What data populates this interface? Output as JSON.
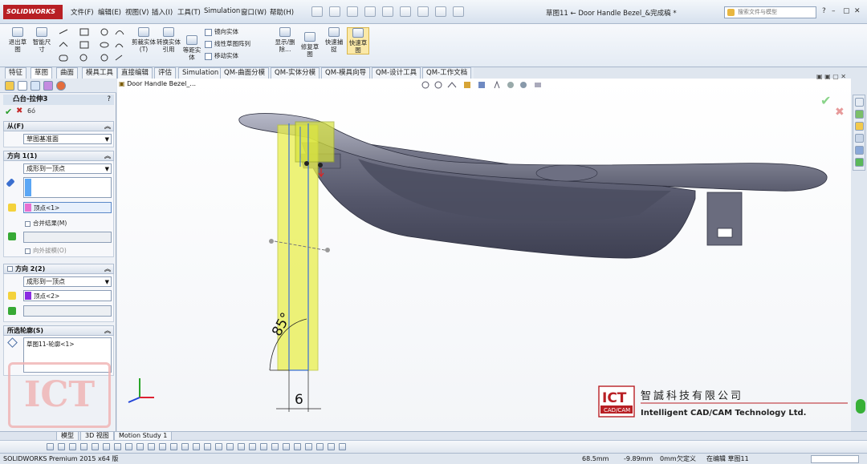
{
  "app": {
    "logo_text": "SOLIDWORKS"
  },
  "menu": [
    "文件(F)",
    "编辑(E)",
    "视图(V)",
    "插入(I)",
    "工具(T)",
    "Simulation",
    "窗口(W)",
    "帮助(H)"
  ],
  "window_title": "草图11 ← Door Handle Bezel_&完成稿 *",
  "search": {
    "placeholder": "搜索文件与模型"
  },
  "window_buttons": [
    "?",
    "–",
    "▢",
    "✕"
  ],
  "ribbon": {
    "large_buttons": [
      "退出草图",
      "智能尺寸",
      "剪裁实体(T)",
      "转换实体引用",
      "等距实体",
      "显示/删除…",
      "修复草图",
      "快速捕捉",
      "快速草图"
    ],
    "small_items": [
      "镜向实体",
      "线性草图阵列",
      "移动实体"
    ]
  },
  "tabs": [
    "特征",
    "草图",
    "曲面",
    "模具工具",
    "直接编辑",
    "评估",
    "Simulation",
    "QM-曲面分模",
    "QM-实体分模",
    "QM-模具向导",
    "QM-设计工具",
    "QM-工作文档"
  ],
  "active_tab": "草图",
  "panel": {
    "feature_title": "凸台-拉伸3",
    "help": "?",
    "ok": "✔",
    "cancel": "✖",
    "preview": "6ó",
    "from": {
      "header": "从(F)",
      "value": "草图基准面"
    },
    "dir1": {
      "header": "方向 1(1)",
      "end_condition": "成形到一顶点",
      "vertex": "顶点<1>",
      "merge_label": "合并结果(M)",
      "draft_label": "向外拔模(O)"
    },
    "dir2": {
      "header": "方向 2(2)",
      "end_condition": "成形到一顶点",
      "vertex": "顶点<2>"
    },
    "contours": {
      "header": "所选轮廓(S)",
      "value": "草图11-轮廓<1>"
    }
  },
  "graphics": {
    "tree_label": "Door Handle Bezel_...",
    "angle_dim": "85°",
    "width_dim": "6"
  },
  "watermark": {
    "cn": "智誠科技有限公司",
    "en": "Intelligent CAD/CAM Technology Ltd.",
    "badge": "ICT",
    "badge_sub": "CAD/CAM"
  },
  "bottom_tabs": [
    "模型",
    "3D 视图",
    "Motion Study 1"
  ],
  "status": {
    "version": "SOLIDWORKS Premium 2015 x64 版",
    "x": "68.5mm",
    "y": "-9.89mm",
    "z": "0mm",
    "state": "欠定义",
    "editing": "在编辑 草图11"
  },
  "colors": {
    "brand": "#b81f24",
    "model": "#5a5c6e",
    "preview": "#e6ee3a",
    "sketch": "#3a6fd8"
  }
}
